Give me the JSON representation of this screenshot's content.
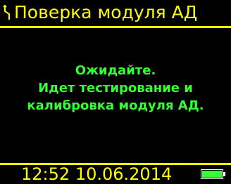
{
  "title_bar": {
    "icon": "tool-icon",
    "title": "Поверка модуля АД"
  },
  "message": {
    "lines": [
      "Ожидайте.",
      "Идет тестирование и",
      "калибровка модуля АД."
    ]
  },
  "status_bar": {
    "time": "12:52",
    "date": "10.06.2014",
    "battery_icon": "battery-icon",
    "battery_level": 1.0
  },
  "colors": {
    "background": "#000000",
    "title_text": "#ffff00",
    "message_text": "#33ff33",
    "battery_fill": "#33ff33"
  }
}
